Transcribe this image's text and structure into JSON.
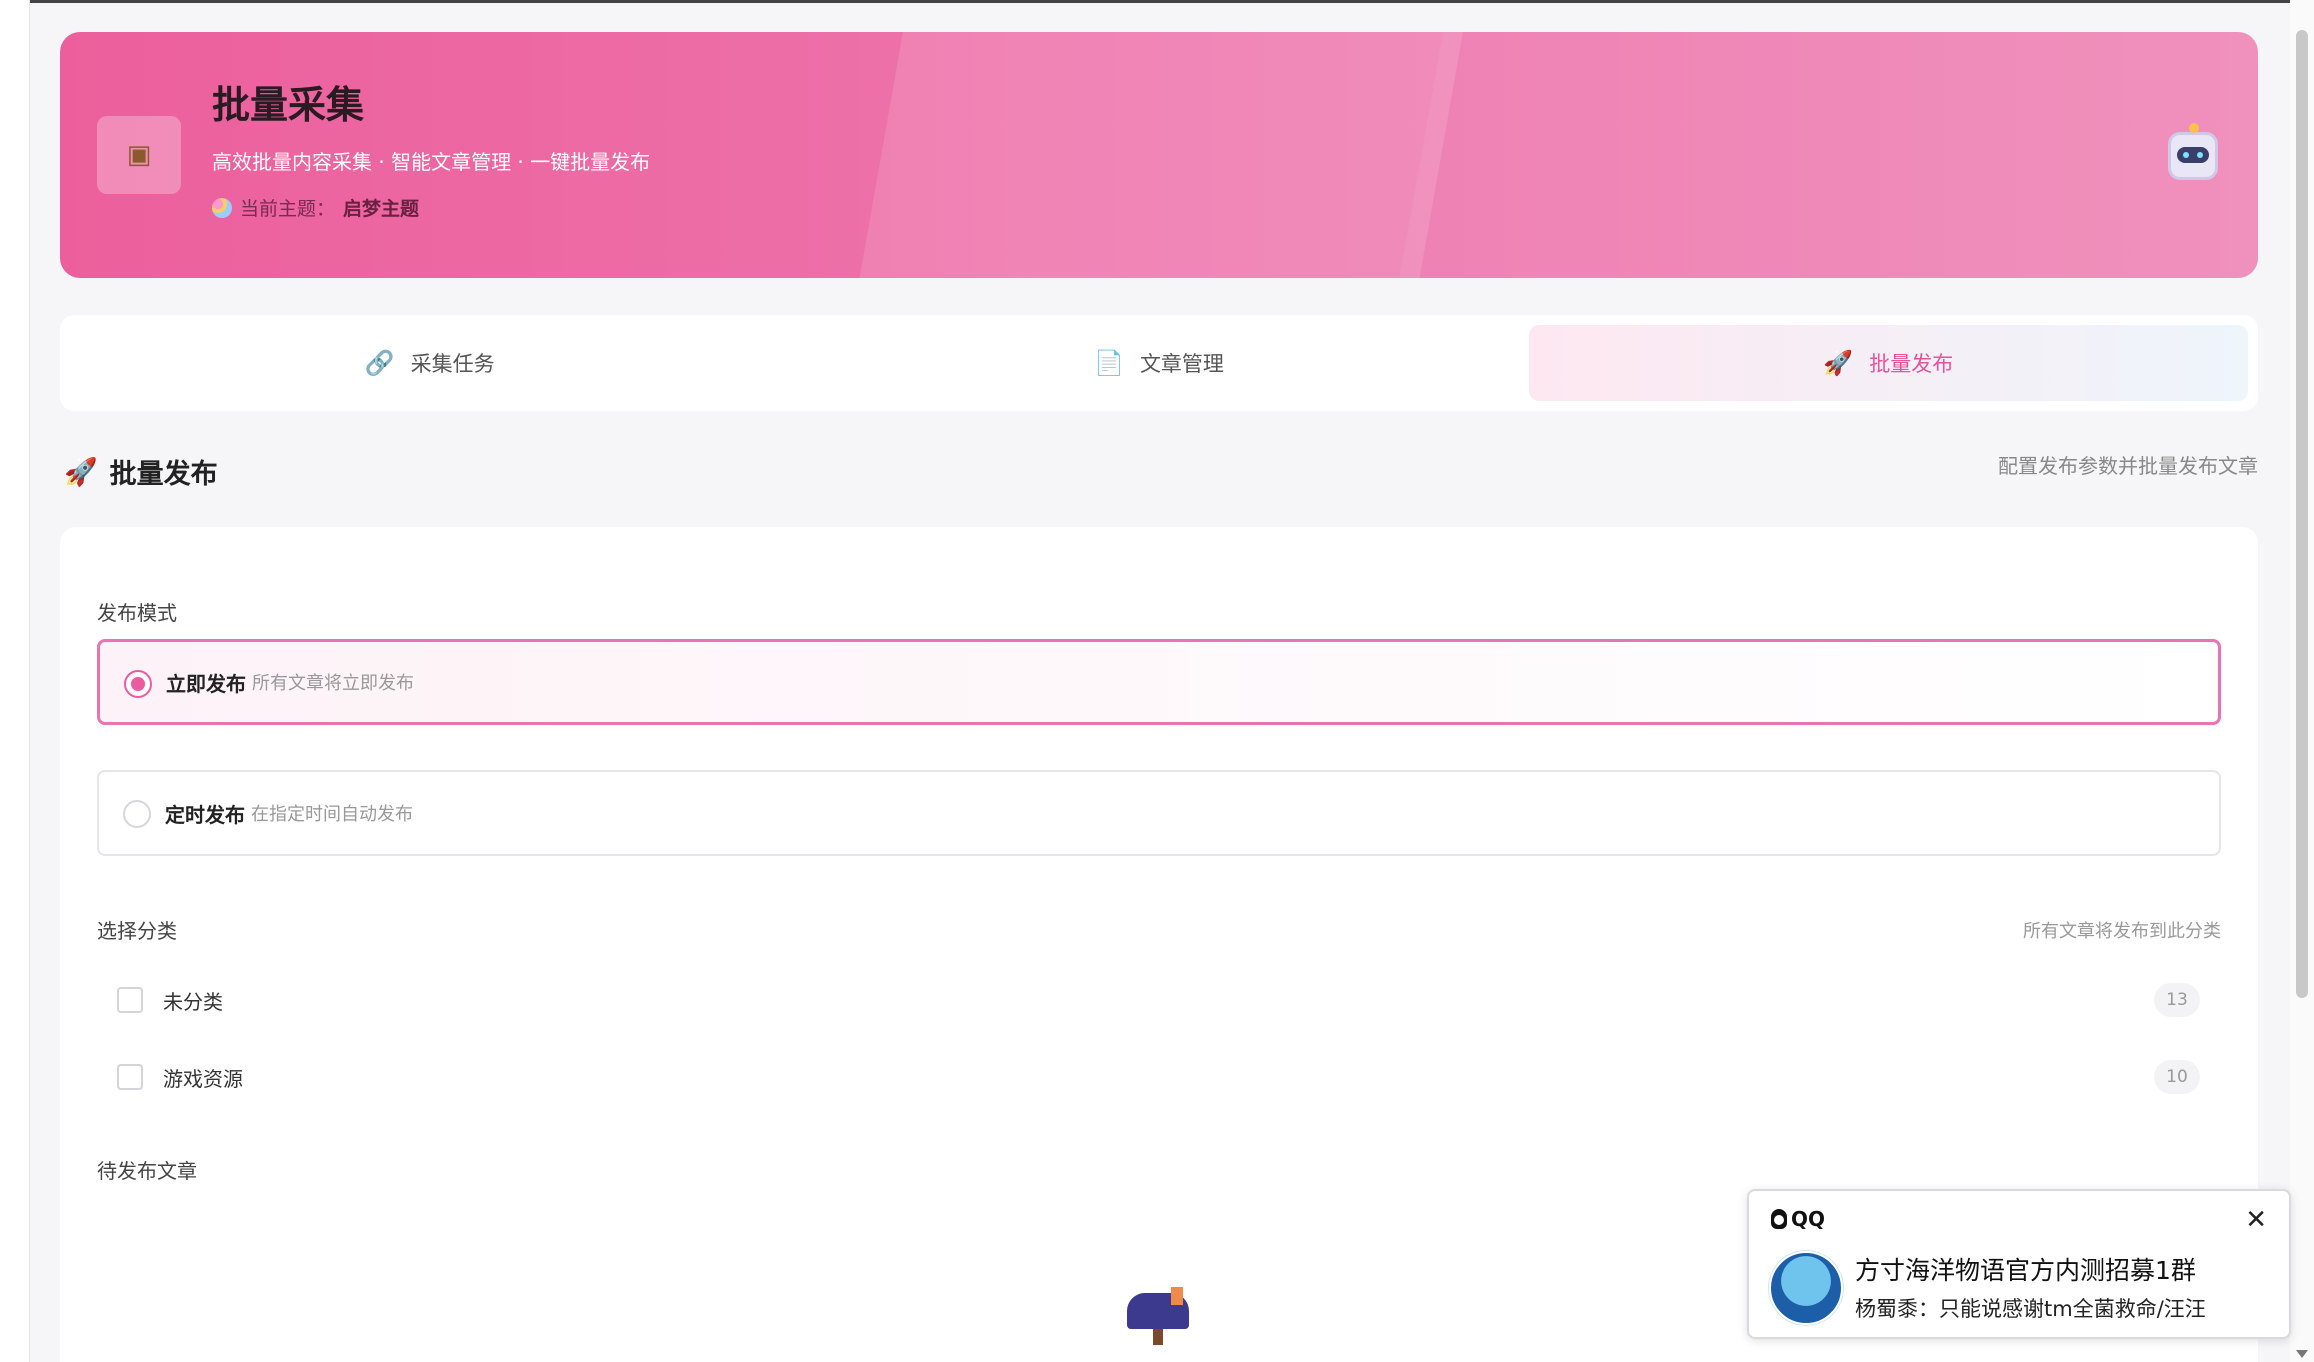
{
  "hero": {
    "icon": "package-icon",
    "title": "批量采集",
    "subtitle": "高效批量内容采集 · 智能文章管理 · 一键批量发布",
    "theme_prefix": "当前主题：",
    "theme_name": "启梦主题"
  },
  "tabs": [
    {
      "label": "采集任务",
      "icon": "link-icon",
      "active": false
    },
    {
      "label": "文章管理",
      "icon": "document-icon",
      "active": false
    },
    {
      "label": "批量发布",
      "icon": "rocket-icon",
      "active": true
    }
  ],
  "section": {
    "title": "批量发布",
    "description": "配置发布参数并批量发布文章"
  },
  "publish": {
    "mode_label": "发布模式",
    "modes": [
      {
        "title": "立即发布",
        "desc": "所有文章将立即发布",
        "selected": true
      },
      {
        "title": "定时发布",
        "desc": "在指定时间自动发布",
        "selected": false
      }
    ],
    "category_label": "选择分类",
    "category_hint": "所有文章将发布到此分类",
    "categories": [
      {
        "name": "未分类",
        "count": "13"
      },
      {
        "name": "游戏资源",
        "count": "10"
      }
    ],
    "pending_label": "待发布文章"
  },
  "notification": {
    "app": "QQ",
    "title": "方寸海洋物语官方内测招募1群",
    "message": "杨蜀黍：只能说感谢tm全菌救命/汪汪"
  },
  "colors": {
    "accent": "#ea5c9f",
    "hero_start": "#ec5f9c",
    "hero_end": "#f08ab8"
  }
}
